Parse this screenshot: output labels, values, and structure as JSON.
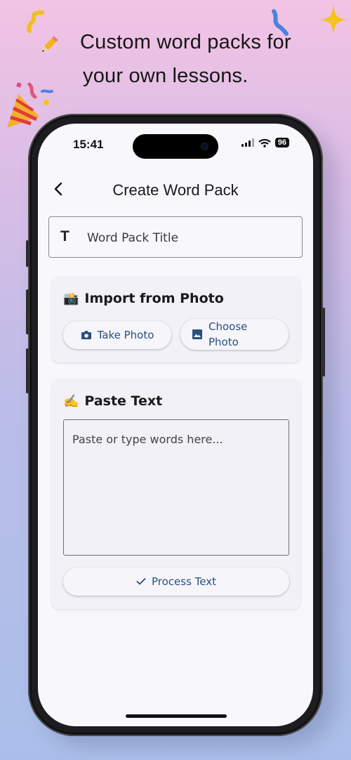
{
  "promo": {
    "line1": "Custom word packs for",
    "line2": "your own lessons."
  },
  "status_bar": {
    "time": "15:41",
    "battery": "96"
  },
  "nav": {
    "title": "Create Word Pack"
  },
  "title_field": {
    "icon": "T",
    "placeholder": "Word Pack Title"
  },
  "import_card": {
    "emoji": "📸",
    "heading": "Import from Photo",
    "take_photo": "Take Photo",
    "choose_photo": "Choose Photo"
  },
  "paste_card": {
    "emoji": "✍️",
    "heading": "Paste Text",
    "textarea_placeholder": "Paste or type words here...",
    "process_button": "Process Text"
  },
  "colors": {
    "accent": "#2a4f7f",
    "screen_bg": "#f7f7fc",
    "card_bg": "#f1f1f7"
  }
}
